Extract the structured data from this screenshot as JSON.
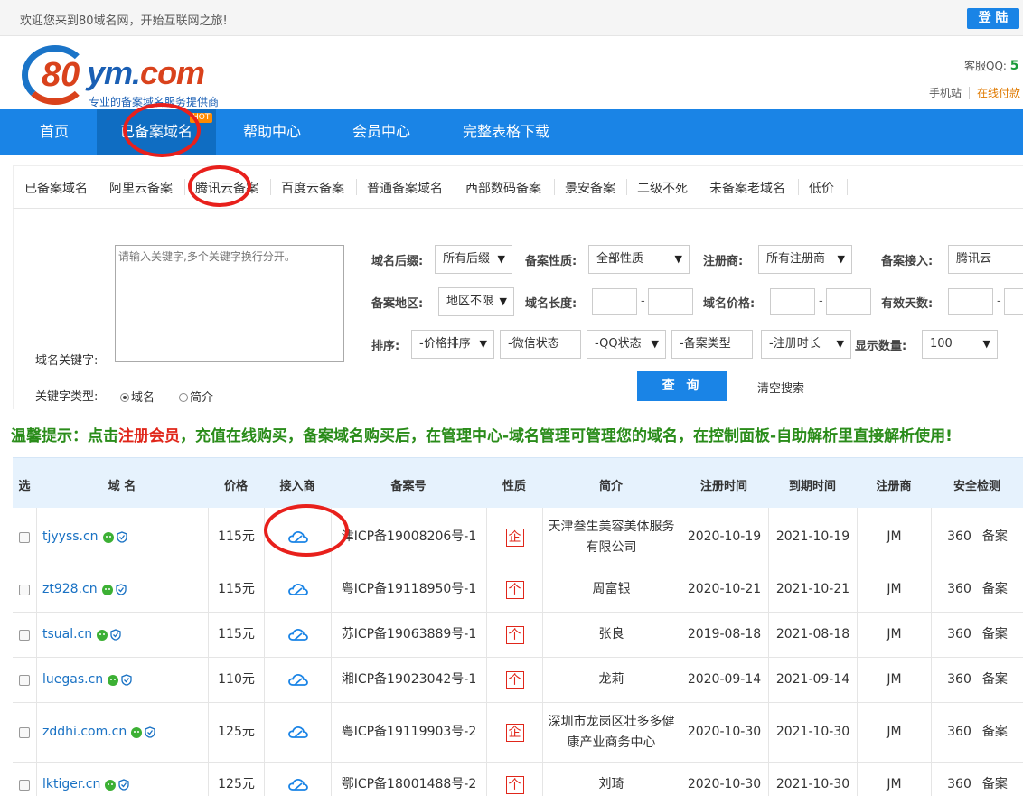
{
  "topbar": {
    "welcome": "欢迎您来到80域名网，开始互联网之旅!",
    "login": "登 陆"
  },
  "header": {
    "logo_80": "80",
    "logo_ym": "ym.",
    "logo_com": "com",
    "slogan": "专业的备案域名服务提供商",
    "qq_label": "客服QQ:",
    "qq_value": "5",
    "mobile": "手机站",
    "pay": "在线付款"
  },
  "nav": {
    "items": [
      "首页",
      "已备案域名",
      "帮助中心",
      "会员中心",
      "完整表格下载"
    ],
    "hot": "HOT"
  },
  "tabs": [
    "已备案域名",
    "阿里云备案",
    "腾讯云备案",
    "百度云备案",
    "普通备案域名",
    "西部数码备案",
    "景安备案",
    "二级不死",
    "未备案老域名",
    "低价"
  ],
  "search": {
    "keyword_label": "域名关键字:",
    "keyword_placeholder": "请输入关键字,多个关键字换行分开。",
    "keyword_type_label": "关键字类型:",
    "type_domain": "域名",
    "type_intro": "简介",
    "suffix_label": "域名后缀:",
    "suffix_value": "所有后缀",
    "nature_label": "备案性质:",
    "nature_value": "全部性质",
    "registrar_label": "注册商:",
    "registrar_value": "所有注册商",
    "access_label": "备案接入:",
    "access_value": "腾讯云",
    "region_label": "备案地区:",
    "region_value": "地区不限",
    "length_label": "域名长度:",
    "price_label": "域名价格:",
    "days_label": "有效天数:",
    "sort_label": "排序:",
    "sort_price": "-价格排序",
    "sort_wechat": "-微信状态",
    "sort_qq": "-QQ状态",
    "sort_type": "-备案类型",
    "sort_reg": "-注册时长",
    "count_label": "显示数量:",
    "count_value": "100",
    "dash": "-",
    "query_button": "查 询",
    "clear_button": "清空搜索"
  },
  "tip": {
    "part1": "温馨提示：点击",
    "register": "注册会员",
    "part2": "，充值在线购买，备案域名购买后，在管理中心-域名管理可管理您的域名，在控制面板-自助解析里直接解析使用!"
  },
  "table": {
    "headers": [
      "选",
      "域 名",
      "价格",
      "接入商",
      "备案号",
      "性质",
      "简介",
      "注册时间",
      "到期时间",
      "注册商",
      "安全检测"
    ],
    "rows": [
      {
        "domain": "tjyyss.cn",
        "price": "115元",
        "icp": "津ICP备19008206号-1",
        "nature": "企",
        "intro": "天津叁生美容美体服务有限公司",
        "reg": "2020-10-19",
        "exp": "2021-10-19",
        "registrar": "JM",
        "s360": "360",
        "sba": "备案"
      },
      {
        "domain": "zt928.cn",
        "price": "115元",
        "icp": "粤ICP备19118950号-1",
        "nature": "个",
        "intro": "周富银",
        "reg": "2020-10-21",
        "exp": "2021-10-21",
        "registrar": "JM",
        "s360": "360",
        "sba": "备案"
      },
      {
        "domain": "tsual.cn",
        "price": "115元",
        "icp": "苏ICP备19063889号-1",
        "nature": "个",
        "intro": "张良",
        "reg": "2019-08-18",
        "exp": "2021-08-18",
        "registrar": "JM",
        "s360": "360",
        "sba": "备案"
      },
      {
        "domain": "luegas.cn",
        "price": "110元",
        "icp": "湘ICP备19023042号-1",
        "nature": "个",
        "intro": "龙莉",
        "reg": "2020-09-14",
        "exp": "2021-09-14",
        "registrar": "JM",
        "s360": "360",
        "sba": "备案"
      },
      {
        "domain": "zddhi.com.cn",
        "price": "125元",
        "icp": "粤ICP备19119903号-2",
        "nature": "企",
        "intro": "深圳市龙岗区壮多多健康产业商务中心",
        "reg": "2020-10-30",
        "exp": "2021-10-30",
        "registrar": "JM",
        "s360": "360",
        "sba": "备案"
      },
      {
        "domain": "lktiger.cn",
        "price": "125元",
        "icp": "鄂ICP备18001488号-2",
        "nature": "个",
        "intro": "刘琦",
        "reg": "2020-10-30",
        "exp": "2021-10-30",
        "registrar": "JM",
        "s360": "360",
        "sba": "备案"
      }
    ]
  },
  "colors": {
    "primary": "#1a84e6",
    "tip": "#2a8c1a",
    "alert": "#e0261a",
    "annotation": "#e8201c"
  }
}
